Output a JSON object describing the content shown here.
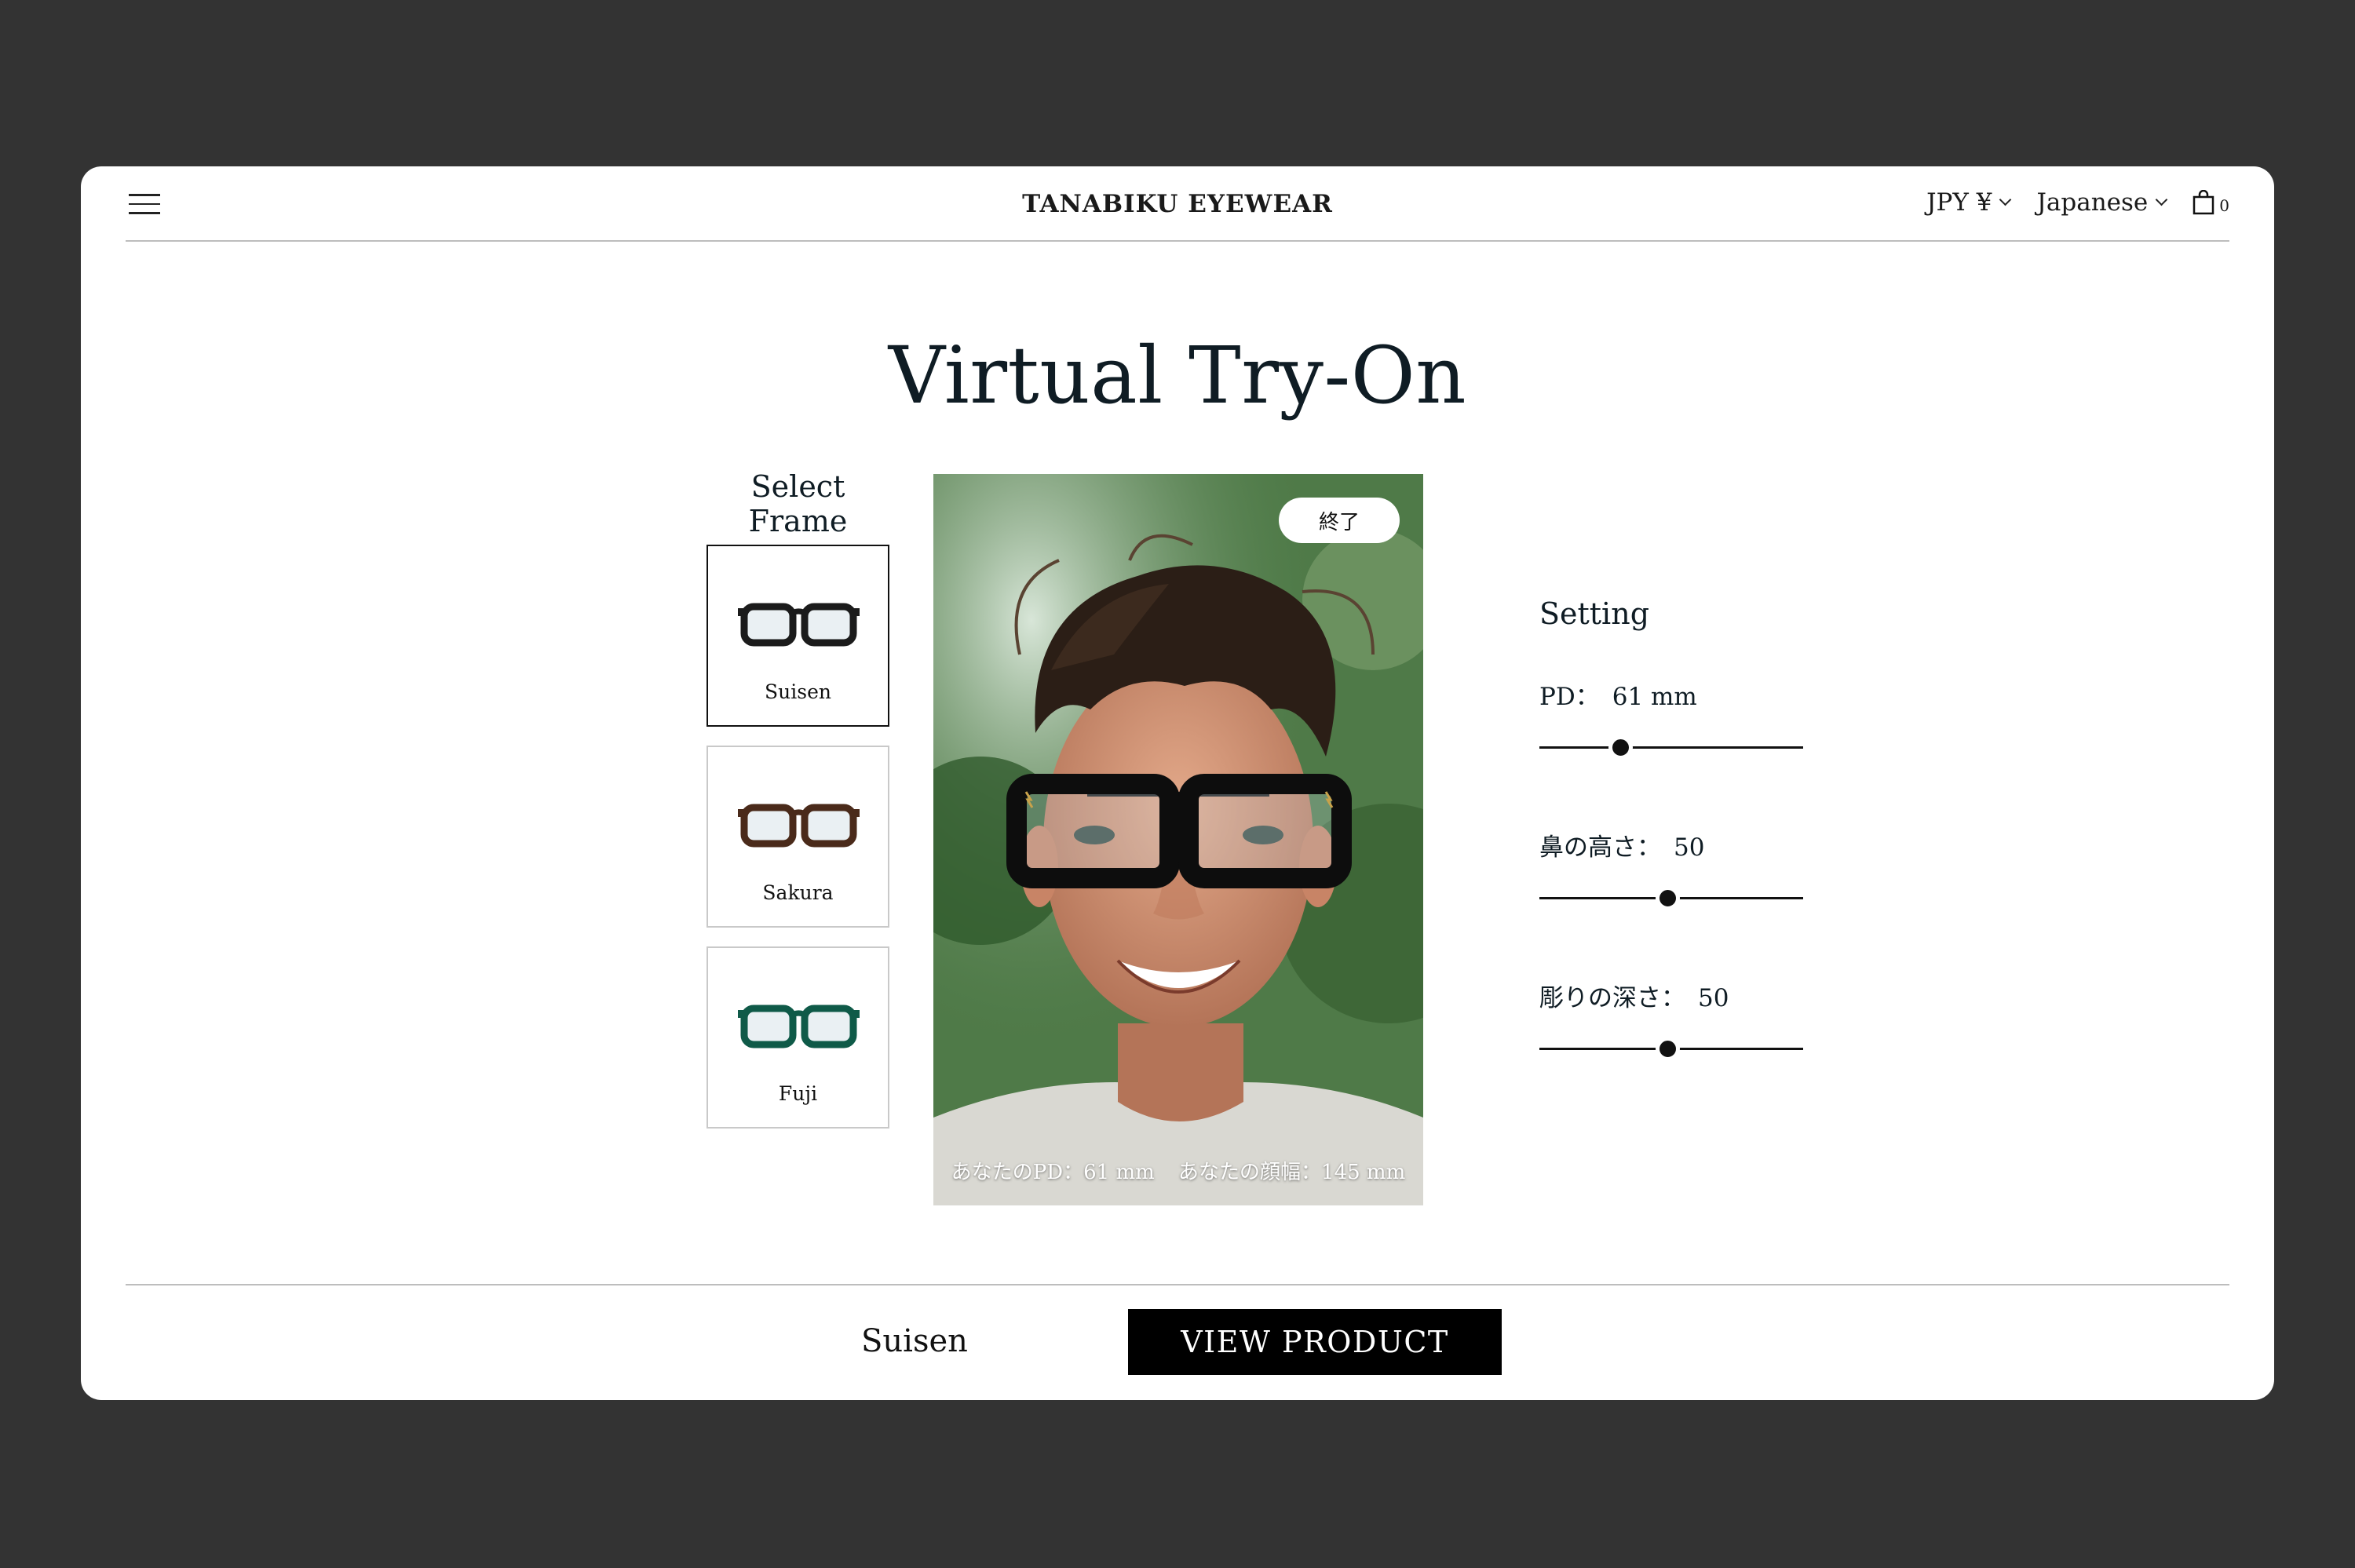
{
  "header": {
    "brand": "TANABIKU EYEWEAR",
    "currency": "JPY ¥",
    "language": "Japanese",
    "cart_count": "0"
  },
  "page": {
    "title": "Virtual Try-On"
  },
  "frames": {
    "label": "Select Frame",
    "items": [
      {
        "name": "Suisen",
        "color": "#1b1b1b",
        "selected": true
      },
      {
        "name": "Sakura",
        "color": "#4a2a1a",
        "selected": false
      },
      {
        "name": "Fuji",
        "color": "#0f5a48",
        "selected": false
      }
    ]
  },
  "preview": {
    "end_label": "終了",
    "pd_text": "あなたのPD：61 mm",
    "face_width_text": "あなたの顔幅：145 mm"
  },
  "settings": {
    "title": "Setting",
    "sliders": [
      {
        "label": "PD：",
        "value": "61 mm",
        "level": 0.32
      },
      {
        "label": "鼻の高さ：",
        "value": "50",
        "level": 0.5
      },
      {
        "label": "彫りの深さ：",
        "value": "50",
        "level": 0.5
      }
    ]
  },
  "footer": {
    "selected_frame": "Suisen",
    "view_label": "VIEW PRODUCT"
  }
}
